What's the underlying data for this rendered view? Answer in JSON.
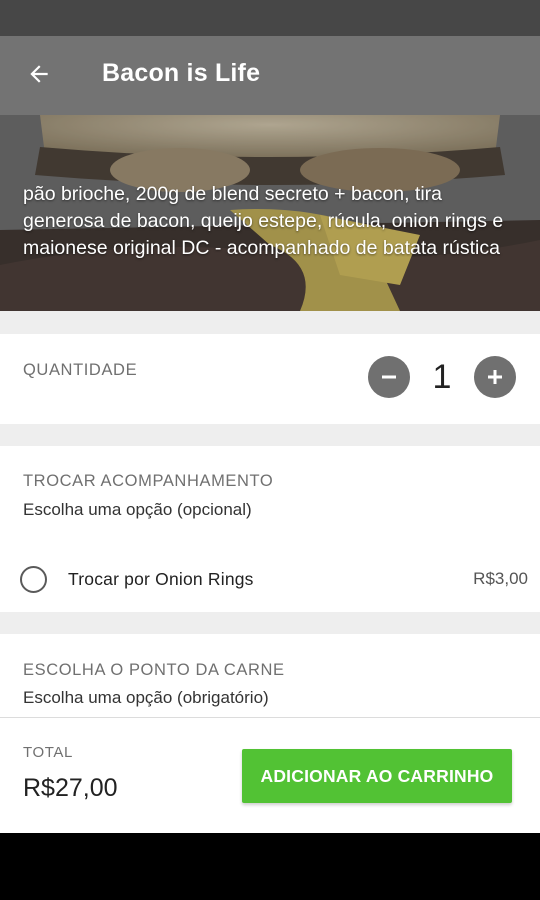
{
  "colors": {
    "status_bar": "#474747",
    "app_bar": "#737373",
    "accent_green": "#52c234",
    "background": "#eeeeee"
  },
  "header": {
    "back_icon": "arrow-left-icon",
    "title": "Bacon is Life"
  },
  "product": {
    "description": "pão brioche, 200g de blend secreto + bacon, tira generosa de bacon, queijo estepe, rúcula, onion rings e maionese original DC - acompanhado de batata rústica"
  },
  "quantity": {
    "label": "QUANTIDADE",
    "value": "1",
    "decrease_icon": "minus-icon",
    "increase_icon": "plus-icon"
  },
  "side_swap": {
    "title": "TROCAR ACOMPANHAMENTO",
    "subtitle": "Escolha uma opção (opcional)",
    "options": [
      {
        "label": "Trocar por Onion Rings",
        "price": "R$3,00",
        "selected": false
      }
    ]
  },
  "meat_point": {
    "title": "ESCOLHA O PONTO DA CARNE",
    "subtitle": "Escolha uma opção (obrigatório)"
  },
  "footer": {
    "total_label": "TOTAL",
    "total_value": "R$27,00",
    "add_button": "ADICIONAR AO CARRINHO"
  }
}
